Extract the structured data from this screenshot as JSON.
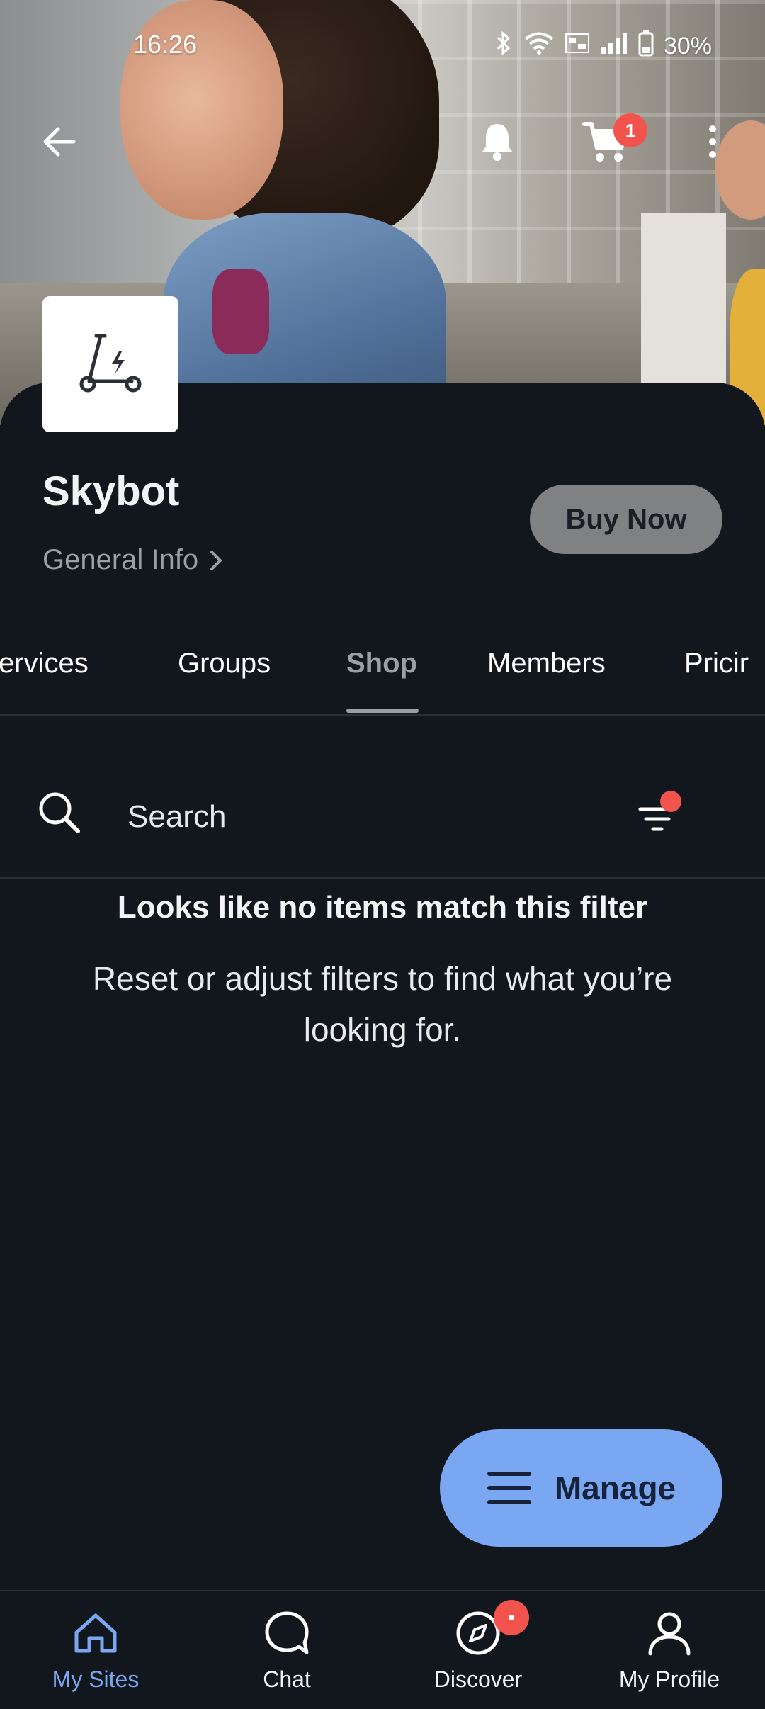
{
  "status_bar": {
    "time": "16:26",
    "battery": "30%"
  },
  "header": {
    "cart_count": "1"
  },
  "site": {
    "title": "Skybot",
    "general_info_label": "General Info",
    "buy_now_label": "Buy Now"
  },
  "tabs": [
    {
      "label": "ervices",
      "active": false
    },
    {
      "label": "Groups",
      "active": false
    },
    {
      "label": "Shop",
      "active": true
    },
    {
      "label": "Members",
      "active": false
    },
    {
      "label": "Pricir",
      "active": false
    }
  ],
  "search": {
    "placeholder": "Search"
  },
  "empty_state": {
    "title": "Looks like no items match this filter",
    "description": "Reset or adjust filters to find what you’re looking for."
  },
  "manage_button": {
    "label": "Manage"
  },
  "bottom_nav": [
    {
      "label": "My Sites",
      "icon": "home-icon",
      "active": true
    },
    {
      "label": "Chat",
      "icon": "chat-icon",
      "active": false
    },
    {
      "label": "Discover",
      "icon": "compass-icon",
      "active": false
    },
    {
      "label": "My Profile",
      "icon": "profile-icon",
      "active": false
    }
  ],
  "colors": {
    "background": "#12161d",
    "accent": "#7aa7f2",
    "badge": "#f3534d",
    "buy_now_bg": "#7f8183"
  }
}
